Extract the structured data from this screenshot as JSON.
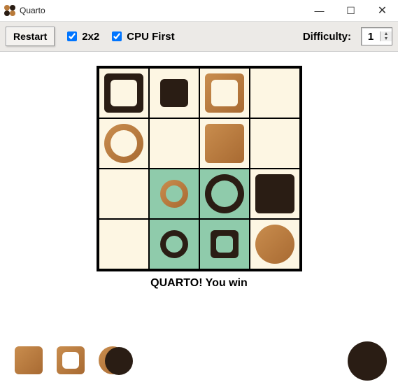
{
  "window": {
    "title": "Quarto"
  },
  "toolbar": {
    "restart_label": "Restart",
    "opt_2x2_label": "2x2",
    "opt_2x2_checked": true,
    "opt_cpu_label": "CPU First",
    "opt_cpu_checked": true,
    "difficulty_label": "Difficulty:",
    "difficulty_value": "1"
  },
  "status_text": "QUARTO! You win",
  "board": {
    "rows": 4,
    "cols": 4,
    "cells": [
      [
        {
          "piece": "dark-tall-square-hollow"
        },
        {
          "piece": "dark-short-square-solid"
        },
        {
          "piece": "light-tall-square-hollow"
        },
        {
          "piece": null
        }
      ],
      [
        {
          "piece": "light-tall-circle-hollow"
        },
        {
          "piece": null
        },
        {
          "piece": "light-tall-square-solid"
        },
        {
          "piece": null
        }
      ],
      [
        {
          "piece": null
        },
        {
          "piece": "light-short-circle-hollow",
          "highlight": true
        },
        {
          "piece": "dark-tall-circle-hollow",
          "highlight": true
        },
        {
          "piece": "dark-tall-square-solid"
        }
      ],
      [
        {
          "piece": null
        },
        {
          "piece": "dark-short-circle-hollow",
          "highlight": true
        },
        {
          "piece": "dark-short-square-hollow",
          "highlight": true
        },
        {
          "piece": "light-tall-circle-solid"
        }
      ]
    ]
  },
  "tray": {
    "row1": [
      "light-short-square-solid",
      "light-short-square-hollow",
      "light-short-circle-solid"
    ],
    "row2_left": "dark-short-circle-solid",
    "row2_right": "dark-tall-circle-solid"
  }
}
